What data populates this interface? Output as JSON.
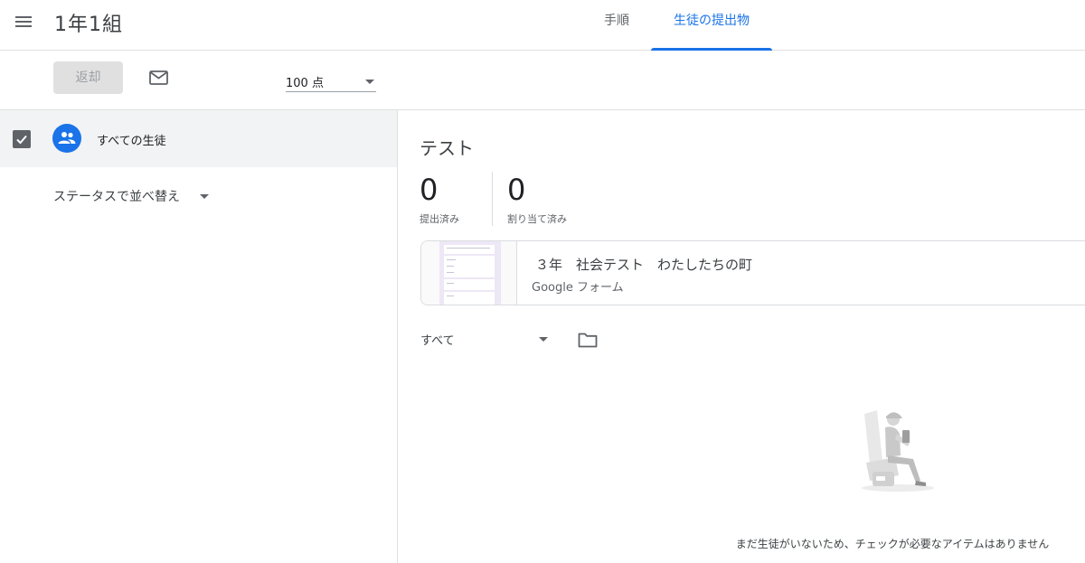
{
  "header": {
    "class_name": "1年1組",
    "tabs": [
      {
        "label": "手順",
        "active": false
      },
      {
        "label": "生徒の提出物",
        "active": true
      }
    ]
  },
  "toolbar": {
    "return_label": "返却",
    "points": "100 点"
  },
  "student_list": {
    "all_students_label": "すべての生徒",
    "sort_label": "ステータスで並べ替え"
  },
  "assignment": {
    "title": "テスト",
    "stats": [
      {
        "value": "0",
        "label": "提出済み"
      },
      {
        "value": "0",
        "label": "割り当て済み"
      }
    ],
    "attachment": {
      "name": "３年　社会テスト　わたしたちの町",
      "type": "Google フォーム"
    },
    "filter_label": "すべて",
    "empty_message": "まだ生徒がいないため、チェックが必要なアイテムはありません"
  },
  "colors": {
    "accent": "#1a73e8",
    "text": "#3c4043",
    "divider": "#e0e0e0"
  },
  "icons": [
    "menu-icon",
    "mail-icon",
    "people-icon",
    "check-icon",
    "folder-icon"
  ]
}
